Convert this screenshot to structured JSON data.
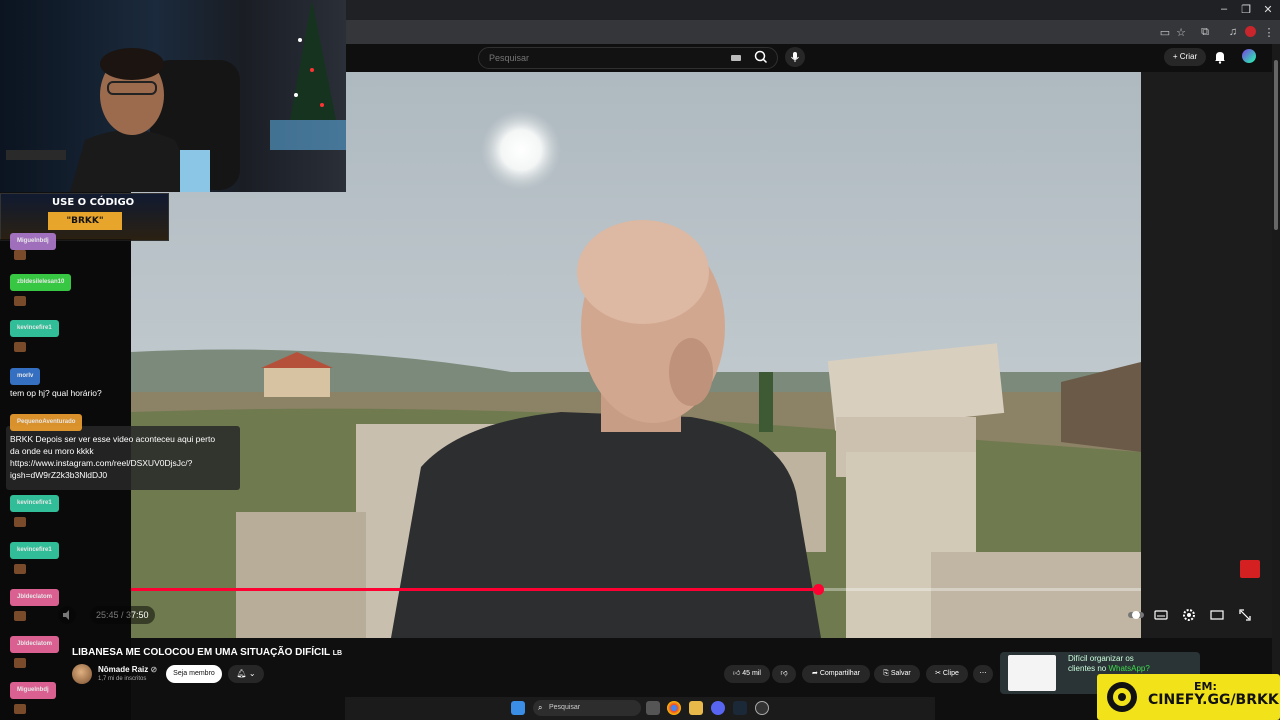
{
  "search": {
    "placeholder": "Pesquisar"
  },
  "header": {
    "create_label": "Criar"
  },
  "player": {
    "time": "25:45 / 37:50",
    "progress_fraction": 0.6805
  },
  "video": {
    "title": "LIBANESA ME COLOCOU EM UMA SITUAÇÃO DIFÍCIL",
    "title_flag": "LB",
    "channel": "Nômade Raiz",
    "subscribers": "1,7 mi de inscritos",
    "join_label": "Seja membro",
    "likes": "45 mil",
    "share_label": "Compartilhar",
    "save_label": "Salvar",
    "clip_label": "Clipe"
  },
  "overlay": {
    "promo_line1": "USE O CÓDIGO",
    "promo_line2": "\"BRKK\"",
    "cinefy_line1": "EM:",
    "cinefy_line2": "CINEFY.GG/BRKK"
  },
  "chat": {
    "names": [
      "zbldesilelesan10",
      "kevincefire1",
      "morlv",
      "PequenoAventurado",
      "kevincefire1",
      "kevincefire1",
      "Jbldeclatom",
      "Jbldeclatom",
      "Miguelnbdj"
    ],
    "message_1": "tem op hj? qual horário?",
    "message_2_lines": [
      "BRKK Depois ser ver esse video aconteceu aqui perto",
      "da onde eu moro kkkk",
      "https://www.instagram.com/reel/DSXUV0DjsJc/?",
      "igsh=dW9rZ2k3b3NldDJ0"
    ]
  },
  "ad": {
    "line1": "Difícil organizar os",
    "line2_prefix": "clientes no ",
    "line2_brand": "WhatsApp?"
  },
  "taskbar": {
    "search_label": "Pesquisar"
  },
  "colors": {
    "accent_red": "#ff0033",
    "chat_green": "#3ddc4a",
    "chat_teal": "#36d1a8",
    "chat_blue": "#3a7bd5",
    "chat_orange": "#f0a030",
    "chat_pink": "#f06aa0",
    "cinefy_yellow": "#f2e21a"
  }
}
